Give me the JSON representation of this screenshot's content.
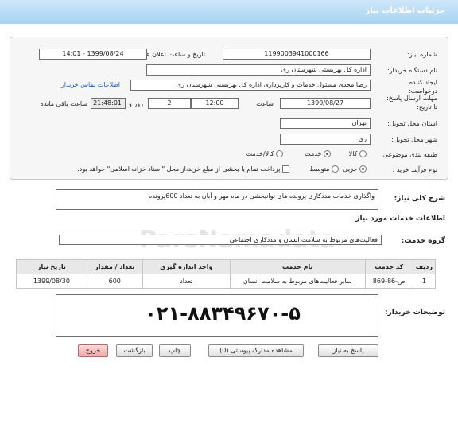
{
  "header": {
    "title": "جزئیات اطلاعات نیاز"
  },
  "fields": {
    "need_number_label": "شماره نیاز:",
    "need_number": "1199003941000166",
    "announce_label": "تاریخ و ساعت اعلان عمومی:",
    "announce_value": "1399/08/24 - 14:01",
    "buyer_org_label": "نام دستگاه خریدار:",
    "buyer_org": "اداره کل بهزیستی شهرستان ری",
    "creator_label_1": "ایجاد کننده",
    "creator_label_2": "درخواست:",
    "creator": "رضا مجدی مسئول خدمات و کارپردازی اداره کل بهزیستی شهرستان ری",
    "contact_link": "اطلاعات تماس خریدار",
    "deadline_label_1": "مهلت ارسال پاسخ:",
    "deadline_label_2": "تا تاریخ:",
    "deadline_date": "1399/08/27",
    "time_label": "ساعت",
    "deadline_time": "12:00",
    "days": "2",
    "days_label": "روز و",
    "remaining_time": "21:48:01",
    "remaining_label": "ساعت باقی مانده",
    "province_label": "استان محل تحویل:",
    "province": "تهران",
    "city_label": "شهر محل تحویل:",
    "city": "ری",
    "category_label": "طبقه بندی موضوعی:",
    "category_options": [
      "کالا",
      "خدمت",
      "کالا/خدمت"
    ],
    "category_selected": "خدمت",
    "process_label": "نوع فرآیند خرید :",
    "process_options": [
      "جزیی",
      "متوسط"
    ],
    "process_selected": "جزیی",
    "treasury_note": "پرداخت تمام یا بخشی از مبلغ خرید،از محل \"اسناد خزانه اسلامی\" خواهد بود."
  },
  "description": {
    "label": "شرح کلی نیاز:",
    "text": "واگذاری خدمات مددکاری پرونده های توانبخشی در ماه مهر و آبان به تعداد 600پرونده"
  },
  "services_info_title": "اطلاعات خدمات مورد نیاز",
  "service_group": {
    "label": "گروه خدمت:",
    "value": "فعالیت‌های مربوط به سلامت انسان و مددکاری اجتماعی"
  },
  "table": {
    "headers": [
      "ردیف",
      "کد خدمت",
      "نام خدمت",
      "واحد اندازه گیری",
      "تعداد / مقدار",
      "تاریخ نیاز"
    ],
    "rows": [
      [
        "1",
        "ص-86-869",
        "سایر فعالیت‌های مربوط به سلامت انسان",
        "تعداد",
        "600",
        "1399/08/30"
      ]
    ]
  },
  "buyer_notes": {
    "label": "توضیحات خریدار:",
    "phone": "۰۲۱-۸۸۳۴۹۶۷۰-۵"
  },
  "watermark": {
    "brand": "ParsNamadata",
    "numbers": "۰۲۱۰۱\n۷۶۵۲\n۸۷۸"
  },
  "buttons": {
    "reply": "پاسخ به نیاز",
    "docs": "مشاهده مدارک پیوستی (0)",
    "print": "چاپ",
    "back": "بازگشت",
    "exit": "خروج"
  }
}
